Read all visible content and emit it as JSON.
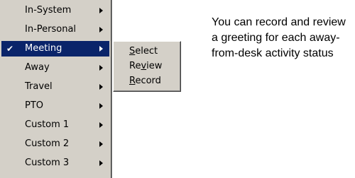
{
  "menu": {
    "items": [
      {
        "label": "In-System",
        "checked": false,
        "active": false
      },
      {
        "label": "In-Personal",
        "checked": false,
        "active": false
      },
      {
        "label": "Meeting",
        "checked": true,
        "active": true
      },
      {
        "label": "Away",
        "checked": false,
        "active": false
      },
      {
        "label": "Travel",
        "checked": false,
        "active": false
      },
      {
        "label": "PTO",
        "checked": false,
        "active": false
      },
      {
        "label": "Custom 1",
        "checked": false,
        "active": false
      },
      {
        "label": "Custom 2",
        "checked": false,
        "active": false
      },
      {
        "label": "Custom 3",
        "checked": false,
        "active": false
      }
    ],
    "check_glyph": "✔"
  },
  "submenu": {
    "items": [
      {
        "prefix": "",
        "accel": "S",
        "rest": "elect"
      },
      {
        "prefix": "Re",
        "accel": "v",
        "rest": "iew"
      },
      {
        "prefix": "",
        "accel": "R",
        "rest": "ecord"
      }
    ]
  },
  "caption": "You can record and review a greeting for each away-from-desk activity status",
  "colors": {
    "menu_bg": "#d4d0c8",
    "highlight_bg": "#0a246a",
    "highlight_text": "#ffffff"
  }
}
